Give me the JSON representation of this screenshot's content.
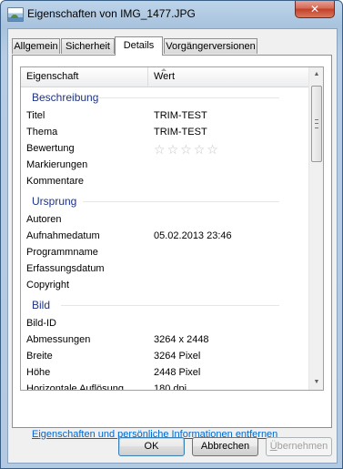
{
  "window": {
    "title": "Eigenschaften von IMG_1477.JPG",
    "close_glyph": "✕",
    "icon": "image-file-icon"
  },
  "tabs": [
    {
      "label": "Allgemein",
      "active": false
    },
    {
      "label": "Sicherheit",
      "active": false
    },
    {
      "label": "Details",
      "active": true
    },
    {
      "label": "Vorgängerversionen",
      "active": false
    }
  ],
  "list": {
    "columns": {
      "property": "Eigenschaft",
      "value": "Wert"
    },
    "groups": [
      {
        "label": "Beschreibung",
        "rows": [
          {
            "key": "Titel",
            "value": "TRIM-TEST"
          },
          {
            "key": "Thema",
            "value": "TRIM-TEST"
          },
          {
            "key": "Bewertung",
            "value": "",
            "rating": {
              "stars": 0,
              "max": 5
            }
          },
          {
            "key": "Markierungen",
            "value": ""
          },
          {
            "key": "Kommentare",
            "value": ""
          }
        ]
      },
      {
        "label": "Ursprung",
        "rows": [
          {
            "key": "Autoren",
            "value": ""
          },
          {
            "key": "Aufnahmedatum",
            "value": "05.02.2013 23:46"
          },
          {
            "key": "Programmname",
            "value": ""
          },
          {
            "key": "Erfassungsdatum",
            "value": ""
          },
          {
            "key": "Copyright",
            "value": ""
          }
        ]
      },
      {
        "label": "Bild",
        "rows": [
          {
            "key": "Bild-ID",
            "value": ""
          },
          {
            "key": "Abmessungen",
            "value": "3264 x 2448"
          },
          {
            "key": "Breite",
            "value": "3264 Pixel"
          },
          {
            "key": "Höhe",
            "value": "2448 Pixel"
          },
          {
            "key": "Horizontale Auflösung",
            "value": "180 dpi"
          }
        ]
      }
    ],
    "scrollbar": {
      "up_glyph": "▲",
      "down_glyph": "▼",
      "position_fraction": 0.0
    }
  },
  "link": "Eigenschaften und persönliche Informationen entfernen",
  "buttons": {
    "ok": "OK",
    "cancel": "Abbrechen",
    "apply_accel": "Ü",
    "apply_rest": "bernehmen"
  },
  "colors": {
    "group_header": "#1e3287",
    "link": "#0066cc",
    "window_frame": "#b4cae0",
    "close_button": "#c3402a"
  }
}
